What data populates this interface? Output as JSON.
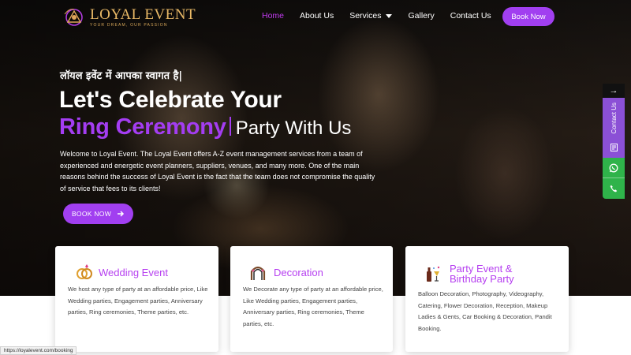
{
  "logo": {
    "title": "LOYAL EVENT",
    "tagline": "YOUR DREAM, OUR PASSION"
  },
  "nav": {
    "items": [
      {
        "label": "Home",
        "active": true
      },
      {
        "label": "About Us",
        "active": false
      },
      {
        "label": "Services",
        "active": false,
        "has_dropdown": true
      },
      {
        "label": "Gallery",
        "active": false
      },
      {
        "label": "Contact Us",
        "active": false
      }
    ],
    "book_label": "Book Now"
  },
  "hero": {
    "hindi": "लॉयल इवेंट में आपका स्वागत है|",
    "line1": "Let's Celebrate Your",
    "typed": "Ring Ceremony",
    "tail": "Party With Us",
    "intro": "Welcome to Loyal Event. The Loyal Event offers A-Z event management services from a team of experienced and energetic event planners, suppliers, venues, and many more. One of the main reasons behind the success of Loyal Event is the fact that the team does not compromise the quality of service that fees to its clients!",
    "button_label": "BOOK NOW"
  },
  "side_widget": {
    "contact_label": "Contact Us"
  },
  "cards": [
    {
      "icon": "rings-icon",
      "title": "Wedding Event",
      "text": "We host any type of party at an affordable price, Like Wedding parties, Engagement parties, Anniversary parties, Ring ceremonies, Theme parties, etc."
    },
    {
      "icon": "arch-icon",
      "title": "Decoration",
      "text": "We Decorate any type of party at an affordable price, Like Wedding parties, Engagement parties, Anniversary parties, Ring ceremonies, Theme parties, etc."
    },
    {
      "icon": "party-drinks-icon",
      "title": "Party Event & Birthday Party",
      "text": "Balloon Decoration, Photography, Videography, Catering, Flower Decoration, Reception, Makeup Ladies & Gents, Car Booking & Decoration, Pandit Booking."
    }
  ],
  "status_bar": {
    "url": "https://loyalevent.com/booking"
  },
  "colors": {
    "accent": "#a43df2",
    "whatsapp": "#2fb34a",
    "contact": "#8b50d6",
    "logo_gold": "#e8b866"
  }
}
